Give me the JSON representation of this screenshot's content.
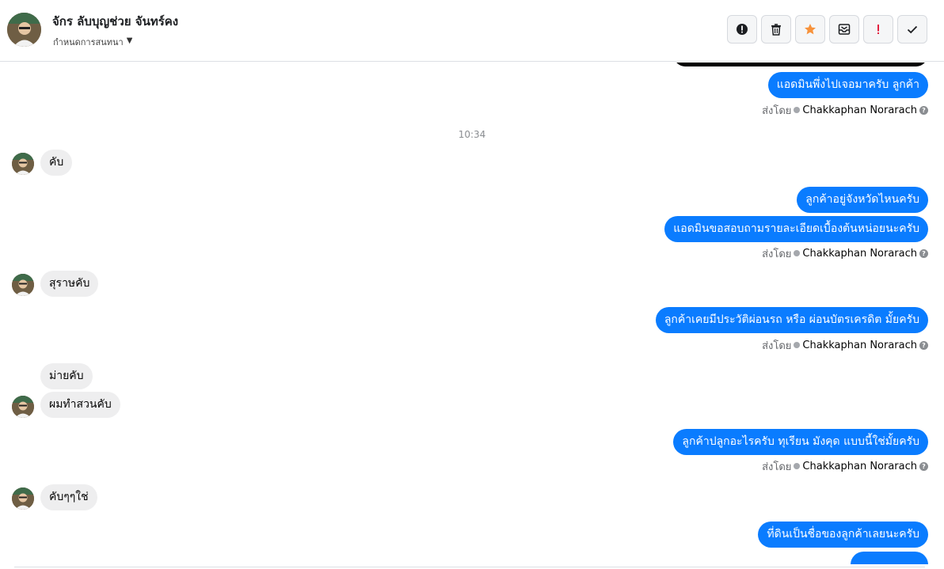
{
  "header": {
    "contact_name": "จักร ลับบุญช่วย จันทร์คง",
    "assign_label": "กำหนดการสนทนา",
    "actions": [
      {
        "name": "report-button",
        "icon": "alert-circle-icon"
      },
      {
        "name": "delete-button",
        "icon": "trash-icon"
      },
      {
        "name": "star-button",
        "icon": "star-icon",
        "color": "#f7923b"
      },
      {
        "name": "move-to-inbox-button",
        "icon": "inbox-icon"
      },
      {
        "name": "follow-up-button",
        "icon": "exclamation-icon",
        "color": "#e41e3f"
      },
      {
        "name": "mark-done-button",
        "icon": "check-icon"
      }
    ]
  },
  "colors": {
    "outgoing_bubble": "#0a7cff",
    "incoming_bubble": "#eeeeef",
    "muted_text": "#65676b"
  },
  "sent_by_prefix": "ส่งโดย",
  "agent_name": "Chakkaphan Norarach",
  "time_separator": "10:34",
  "messages": [
    {
      "dir": "out",
      "text": "แอดมินพึ่งไปเจอมาครับ ลูกค้า"
    },
    {
      "dir": "in",
      "text": "คับ"
    },
    {
      "dir": "out",
      "text": "ลูกค้าอยู่จังหวัดไหนครับ"
    },
    {
      "dir": "out",
      "text": "แอดมินขอสอบถามรายละเอียดเบื้องต้นหน่อยนะครับ"
    },
    {
      "dir": "in",
      "text": "สุราษคับ"
    },
    {
      "dir": "out",
      "text": "ลูกค้าเคยมีประวัติผ่อนรถ หรือ ผ่อนบัตรเครดิต มั้ยครับ"
    },
    {
      "dir": "in",
      "text": "ม่ายคับ"
    },
    {
      "dir": "in",
      "text": "ผมทำสวนคับ"
    },
    {
      "dir": "out",
      "text": "ลูกค้าปลูกอะไรครับ ทุเรียน มังคุด แบบนี้ใช่มั้ยครับ"
    },
    {
      "dir": "in",
      "text": "คับๆๆใช่"
    },
    {
      "dir": "out",
      "text": "ที่ดินเป็นชื่อของลูกค้าเลยนะครับ"
    }
  ]
}
